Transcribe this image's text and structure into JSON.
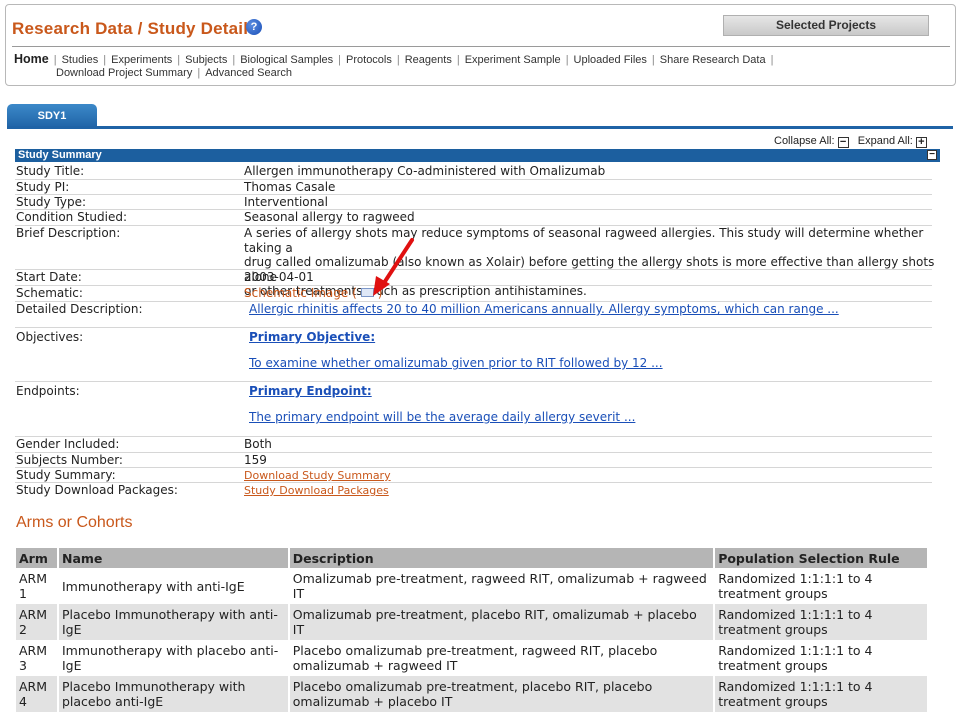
{
  "header": {
    "title": "Research Data / Study Detail",
    "help_glyph": "?",
    "selected_projects": "Selected Projects"
  },
  "nav": {
    "home": "Home",
    "items": [
      "Studies",
      "Experiments",
      "Subjects",
      "Biological Samples",
      "Protocols",
      "Reagents",
      "Experiment Sample",
      "Uploaded Files",
      "Share Research Data"
    ],
    "items_line2": [
      "Download Project Summary",
      "Advanced Search"
    ]
  },
  "tab": {
    "label": "SDY1"
  },
  "controls": {
    "collapse_all": "Collapse All:",
    "expand_all": "Expand All:",
    "minus": "−",
    "plus": "+"
  },
  "summary": {
    "section_title": "Study Summary",
    "fields": {
      "title_label": "Study Title:",
      "title": "Allergen immunotherapy Co-administered with Omalizumab",
      "pi_label": "Study PI:",
      "pi": "Thomas Casale",
      "type_label": "Study Type:",
      "type": "Interventional",
      "condition_label": "Condition Studied:",
      "condition": "Seasonal allergy to ragweed",
      "brief_label": "Brief Description:",
      "brief_line1": "A series of allergy shots may reduce symptoms of seasonal ragweed allergies. This study will determine whether taking a",
      "brief_line2": "drug called omalizumab (also known as Xolair) before getting the allergy shots is more effective than allergy shots alone",
      "brief_line3": "or other treatments, such as prescription antihistamines.",
      "start_label": "Start Date:",
      "start": "2003-04-01",
      "schematic_label": "Schematic:",
      "schematic_pre": "Schematic Image (",
      "schematic_post": ")",
      "detailed_label": "Detailed Description:",
      "detailed": "Allergic rhinitis affects 20 to 40 million Americans annually. Allergy symptoms, which can range ...",
      "objectives_label": "Objectives:",
      "objective_heading": "Primary Objective:",
      "objective": "To examine whether omalizumab given prior to RIT followed by 12 ...",
      "endpoints_label": "Endpoints:",
      "endpoint_heading": "Primary Endpoint:",
      "endpoint": "The primary endpoint will be the average daily allergy severit ...",
      "gender_label": "Gender Included:",
      "gender": "Both",
      "subjects_label": "Subjects Number:",
      "subjects": "159",
      "summary_label": "Study Summary:",
      "summary_link": "Download Study Summary",
      "packages_label": "Study Download Packages:",
      "packages_link": "Study Download Packages"
    }
  },
  "arms": {
    "title": "Arms or Cohorts",
    "columns": [
      "Arm",
      "Name",
      "Description",
      "Population Selection Rule"
    ],
    "rows": [
      {
        "arm": "ARM 1",
        "name": "Immunotherapy with anti-IgE",
        "description": "Omalizumab pre-treatment, ragweed RIT, omalizumab + ragweed IT",
        "rule": "Randomized 1:1:1:1 to 4 treatment groups"
      },
      {
        "arm": "ARM 2",
        "name": "Placebo Immunotherapy with anti-IgE",
        "description": "Omalizumab pre-treatment, placebo RIT, omalizumab + placebo IT",
        "rule": "Randomized 1:1:1:1 to 4 treatment groups"
      },
      {
        "arm": "ARM 3",
        "name": "Immunotherapy with placebo anti-IgE",
        "description": "Placebo omalizumab pre-treatment, ragweed RIT, placebo omalizumab + ragweed IT",
        "rule": "Randomized 1:1:1:1 to 4 treatment groups"
      },
      {
        "arm": "ARM 4",
        "name": "Placebo Immunotherapy with placebo anti-IgE",
        "description": "Placebo omalizumab pre-treatment, placebo RIT, placebo omalizumab + placebo IT",
        "rule": "Randomized 1:1:1:1 to 4 treatment groups"
      }
    ]
  },
  "colors": {
    "brand_orange": "#c9581b",
    "section_blue": "#1c5f9f",
    "link_blue": "#1a4fb8",
    "annotation_red": "#e01010"
  }
}
